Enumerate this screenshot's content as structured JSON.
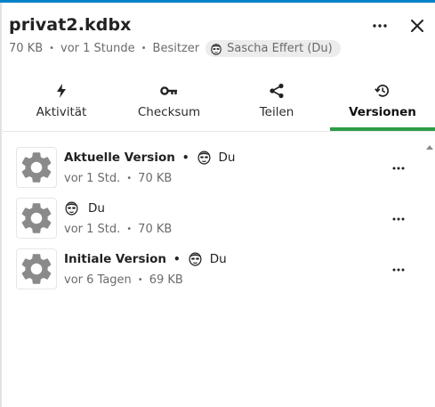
{
  "file": {
    "title": "privat2.kdbx",
    "size": "70 KB",
    "modified": "vor 1 Stunde",
    "owner_label": "Besitzer",
    "owner_name": "Sascha Effert (Du)"
  },
  "header": {
    "more_icon": "more-horizontal-icon",
    "close_icon": "close-icon"
  },
  "tabs": [
    {
      "label": "Aktivität",
      "icon": "lightning-icon"
    },
    {
      "label": "Checksum",
      "icon": "key-icon"
    },
    {
      "label": "Teilen",
      "icon": "share-icon"
    },
    {
      "label": "Versionen",
      "icon": "history-icon",
      "active": true
    }
  ],
  "versions": [
    {
      "name": "Aktuelle Version",
      "user": "Du",
      "time": "vor 1 Std.",
      "size": "70 KB"
    },
    {
      "name": "",
      "user": "Du",
      "time": "vor 1 Std.",
      "size": "70 KB"
    },
    {
      "name": "Initiale Version",
      "user": "Du",
      "time": "vor 6 Tagen",
      "size": "69 KB"
    }
  ],
  "colors": {
    "accent_top": "#0082c9",
    "tab_active": "#2e9b48",
    "muted_text": "#6b6b6b"
  }
}
